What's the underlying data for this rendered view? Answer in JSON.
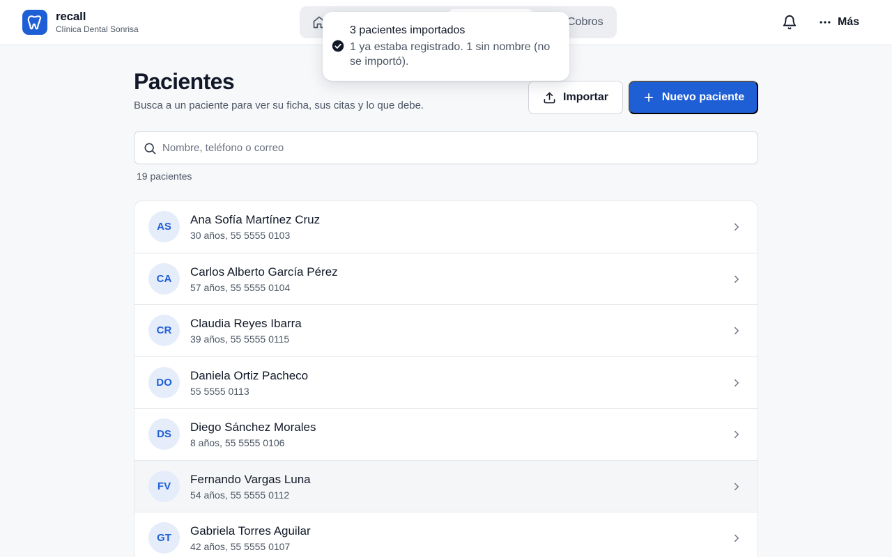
{
  "brand": {
    "name": "recall",
    "clinic": "Clínica Dental Sonrisa",
    "logo_icon": "tooth-icon",
    "color": "#1f5fd6"
  },
  "nav": {
    "cobros_label": "Cobros",
    "home_icon": "home-icon"
  },
  "header": {
    "more_label": "Más",
    "bell_icon": "bell-icon",
    "more_icon": "dots-horizontal-icon"
  },
  "toast": {
    "title": "3 pacientes importados",
    "description": "1 ya estaba registrado. 1 sin nombre (no se importó).",
    "icon": "check-circle-icon"
  },
  "page": {
    "title": "Pacientes",
    "subtitle": "Busca a un paciente para ver su ficha, sus citas y lo que debe.",
    "import_label": "Importar",
    "new_label": "Nuevo paciente"
  },
  "search": {
    "placeholder": "Nombre, teléfono o correo",
    "value": ""
  },
  "count_label": "19 pacientes",
  "patients": [
    {
      "initials": "AS",
      "name": "Ana Sofía Martínez Cruz",
      "meta": "30 años, 55 5555 0103"
    },
    {
      "initials": "CA",
      "name": "Carlos Alberto García Pérez",
      "meta": "57 años, 55 5555 0104"
    },
    {
      "initials": "CR",
      "name": "Claudia Reyes Ibarra",
      "meta": "39 años, 55 5555 0115"
    },
    {
      "initials": "DO",
      "name": "Daniela Ortiz Pacheco",
      "meta": "55 5555 0113"
    },
    {
      "initials": "DS",
      "name": "Diego Sánchez Morales",
      "meta": "8 años, 55 5555 0106"
    },
    {
      "initials": "FV",
      "name": "Fernando Vargas Luna",
      "meta": "54 años, 55 5555 0112"
    },
    {
      "initials": "GT",
      "name": "Gabriela Torres Aguilar",
      "meta": "42 años, 55 5555 0107"
    }
  ]
}
